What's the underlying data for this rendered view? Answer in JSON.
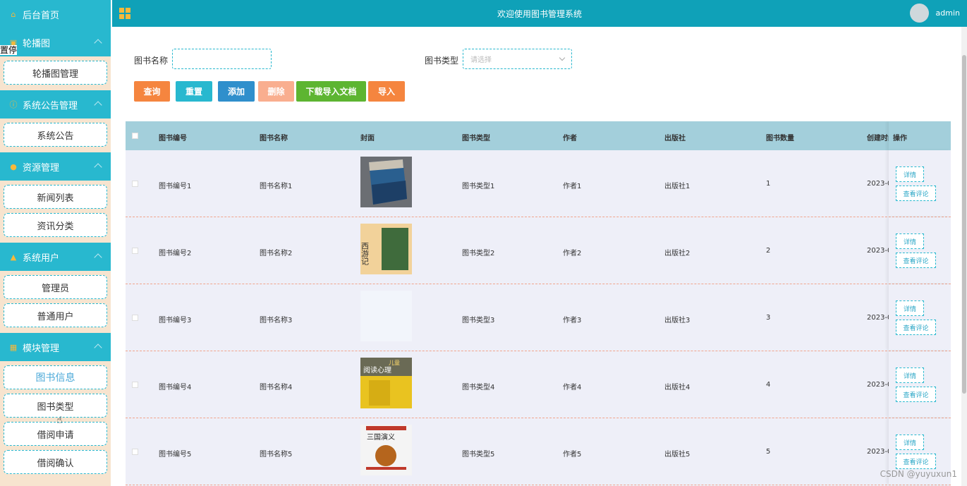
{
  "header": {
    "title": "欢迎使用图书管理系统",
    "user": "admin"
  },
  "sidebar": {
    "home": "后台首页",
    "stray_text": "置停",
    "groups": [
      {
        "label": "轮播图",
        "items": [
          "轮播图管理"
        ]
      },
      {
        "label": "系统公告管理",
        "items": [
          "系统公告"
        ]
      },
      {
        "label": "资源管理",
        "items": [
          "新闻列表",
          "资讯分类"
        ]
      },
      {
        "label": "系统用户",
        "items": [
          "管理员",
          "普通用户"
        ]
      },
      {
        "label": "模块管理",
        "items": [
          "图书信息",
          "图书类型",
          "借阅申请",
          "借阅确认"
        ]
      }
    ]
  },
  "search": {
    "name_label": "图书名称",
    "name_value": "",
    "type_label": "图书类型",
    "type_placeholder": "请选择"
  },
  "buttons": {
    "query": "查询",
    "reset": "重置",
    "add": "添加",
    "delete": "删除",
    "download": "下载导入文档",
    "import": "导入"
  },
  "colors": {
    "primary": "#0fa1b8",
    "query": "#f5853f",
    "reset": "#28b8cf",
    "add": "#2f8fcc",
    "delete": "#f9ae8f",
    "download": "#5db531",
    "import": "#f5853f"
  },
  "table": {
    "columns": [
      "图书编号",
      "图书名称",
      "封面",
      "图书类型",
      "作者",
      "出版社",
      "图书数量",
      "创建时间",
      "操作"
    ],
    "rows": [
      {
        "id": "图书编号1",
        "name": "图书名称1",
        "type": "图书类型1",
        "author": "作者1",
        "publisher": "出版社1",
        "qty": "1",
        "created": "2023-0",
        "cover": "blue-book"
      },
      {
        "id": "图书编号2",
        "name": "图书名称2",
        "type": "图书类型2",
        "author": "作者2",
        "publisher": "出版社2",
        "qty": "2",
        "created": "2023-0",
        "cover": "xiyouji"
      },
      {
        "id": "图书编号3",
        "name": "图书名称3",
        "type": "图书类型3",
        "author": "作者3",
        "publisher": "出版社3",
        "qty": "3",
        "created": "2023-0",
        "cover": "blank"
      },
      {
        "id": "图书编号4",
        "name": "图书名称4",
        "type": "图书类型4",
        "author": "作者4",
        "publisher": "出版社4",
        "qty": "4",
        "created": "2023-0",
        "cover": "child"
      },
      {
        "id": "图书编号5",
        "name": "图书名称5",
        "type": "图书类型5",
        "author": "作者5",
        "publisher": "出版社5",
        "qty": "5",
        "created": "2023-0",
        "cover": "sanguo"
      }
    ],
    "detail_label": "详情",
    "comment_label": "查看评论",
    "cover_texts": {
      "xiyouji": "西游记",
      "child_line1": "儿童",
      "child_line2": "阅读心理",
      "sanguo": "三国演义"
    }
  },
  "watermark": "CSDN @yuyuxun1"
}
